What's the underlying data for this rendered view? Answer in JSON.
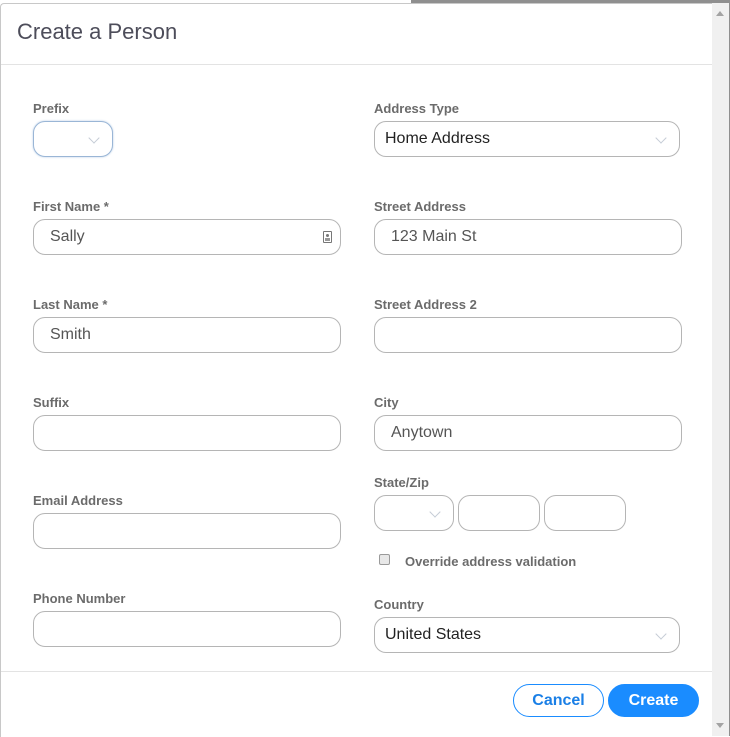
{
  "dialog": {
    "title": "Create a Person"
  },
  "left": {
    "prefix": {
      "label": "Prefix",
      "value": ""
    },
    "first_name": {
      "label": "First Name *",
      "value": "Sally"
    },
    "last_name": {
      "label": "Last Name *",
      "value": "Smith"
    },
    "suffix": {
      "label": "Suffix",
      "value": ""
    },
    "email": {
      "label": "Email Address",
      "value": ""
    },
    "phone": {
      "label": "Phone Number",
      "value": ""
    }
  },
  "right": {
    "address_type": {
      "label": "Address Type",
      "value": "Home Address"
    },
    "street": {
      "label": "Street Address",
      "value": "123 Main St"
    },
    "street2": {
      "label": "Street Address 2",
      "value": ""
    },
    "city": {
      "label": "City",
      "value": "Anytown"
    },
    "state_zip": {
      "label": "State/Zip",
      "state": "",
      "zip": "",
      "zip4": ""
    },
    "override": {
      "label": "Override address validation",
      "checked": false
    },
    "country": {
      "label": "Country",
      "value": "United States"
    }
  },
  "footer": {
    "cancel_label": "Cancel",
    "create_label": "Create"
  },
  "colors": {
    "accent": "#1a8cff"
  }
}
